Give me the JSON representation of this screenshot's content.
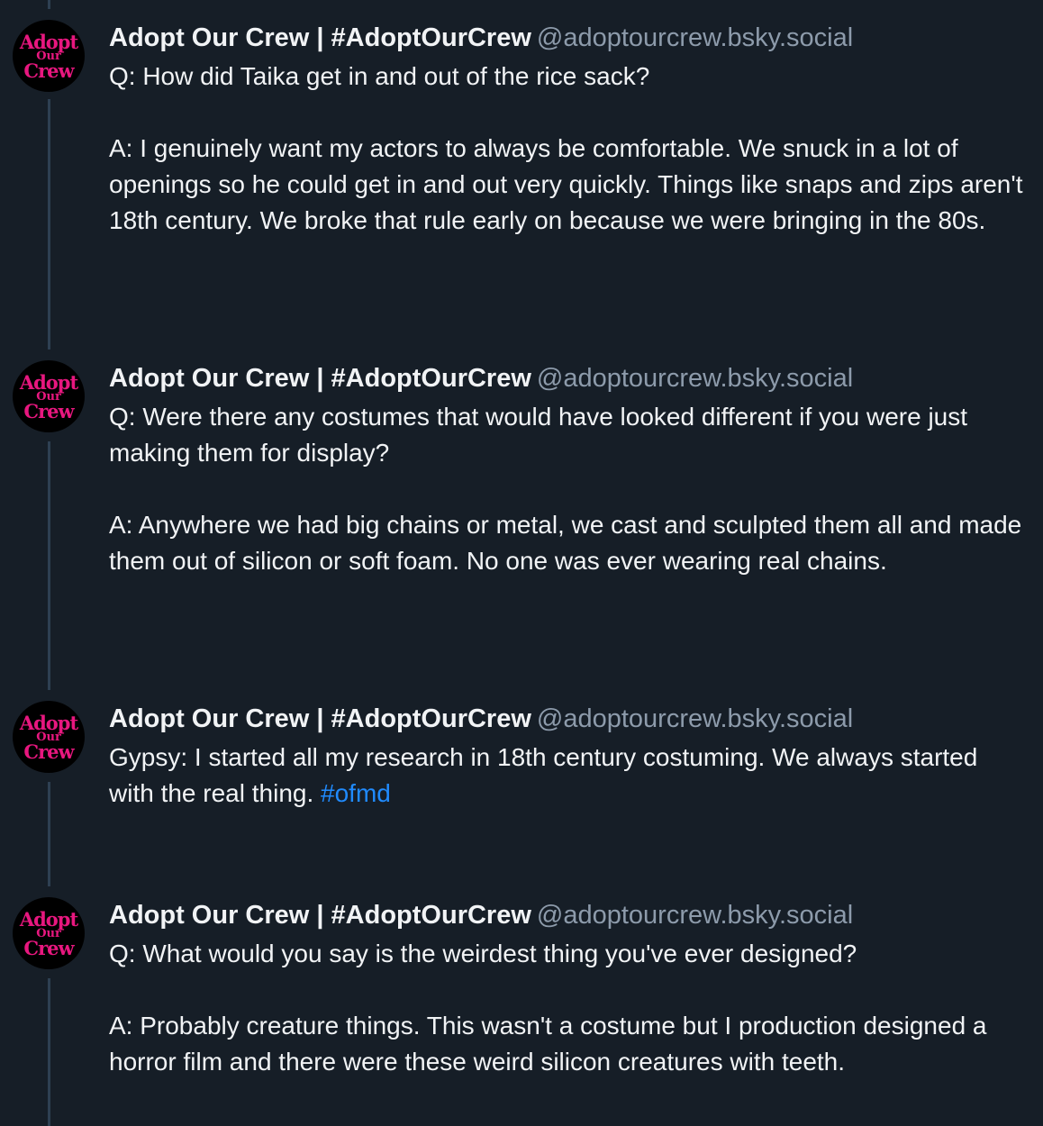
{
  "posts": [
    {
      "author": {
        "display_name": "Adopt Our Crew | #AdoptOurCrew",
        "handle": "@adoptourcrew.bsky.social",
        "avatar_lines": [
          "Adopt",
          "Our",
          "Crew"
        ]
      },
      "paragraphs": [
        "Q: How did Taika get in and out of the rice sack?",
        "A: I genuinely want my actors to always be comfortable. We snuck in a lot of openings so he could get in and out very quickly. Things like snaps and zips aren't 18th century. We broke that rule early on because we were bringing in the 80s."
      ]
    },
    {
      "author": {
        "display_name": "Adopt Our Crew | #AdoptOurCrew",
        "handle": "@adoptourcrew.bsky.social",
        "avatar_lines": [
          "Adopt",
          "Our",
          "Crew"
        ]
      },
      "paragraphs": [
        "Q: Were there any costumes that would have looked different if you were just making them for display?",
        "A: Anywhere we had big chains or metal, we cast and sculpted them all and made them out of silicon or soft foam. No one was ever wearing real chains."
      ]
    },
    {
      "author": {
        "display_name": "Adopt Our Crew | #AdoptOurCrew",
        "handle": "@adoptourcrew.bsky.social",
        "avatar_lines": [
          "Adopt",
          "Our",
          "Crew"
        ]
      },
      "text": "Gypsy: I started all my research in 18th century costuming. We always started with the real thing.",
      "hashtag": "#ofmd"
    },
    {
      "author": {
        "display_name": "Adopt Our Crew | #AdoptOurCrew",
        "handle": "@adoptourcrew.bsky.social",
        "avatar_lines": [
          "Adopt",
          "Our",
          "Crew"
        ]
      },
      "paragraphs": [
        "Q: What would you say is the weirdest thing you've ever designed?",
        "A: Probably creature things. This wasn't a costume but I production designed a horror film and there were these weird silicon creatures with teeth."
      ]
    }
  ],
  "colors": {
    "background": "#161e27",
    "thread_line": "#2e4052",
    "text": "#f1f3f5",
    "handle": "#8d9bab",
    "hashtag": "#208bfe",
    "avatar_text": "#e8177f"
  }
}
